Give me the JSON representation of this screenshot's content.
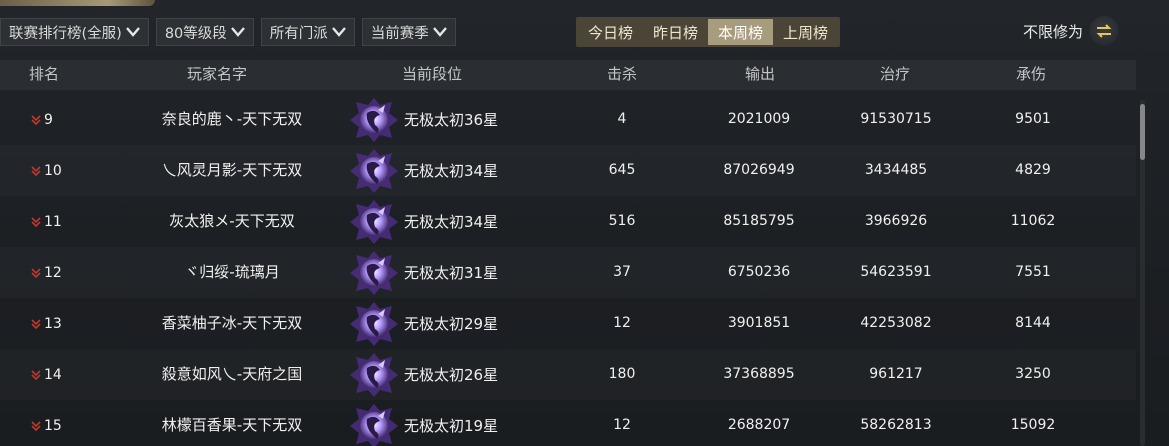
{
  "filters": [
    {
      "label": "联赛排行榜(全服)"
    },
    {
      "label": "80等级段"
    },
    {
      "label": "所有门派"
    },
    {
      "label": "当前赛季"
    }
  ],
  "tabs": [
    {
      "label": "今日榜",
      "active": false
    },
    {
      "label": "昨日榜",
      "active": false
    },
    {
      "label": "本周榜",
      "active": true
    },
    {
      "label": "上周榜",
      "active": false
    }
  ],
  "cultivation": {
    "label": "不限修为",
    "icon": "swap-arrows-icon"
  },
  "table": {
    "headers": {
      "rank": "排名",
      "name": "玩家名字",
      "tier": "当前段位",
      "kills": "击杀",
      "damage": "输出",
      "healing": "治疗",
      "taken": "承伤"
    },
    "rows": [
      {
        "rank": "9",
        "name": "奈良的鹿丶-天下无双",
        "tier": "无极太初36星",
        "kills": "4",
        "damage": "2021009",
        "healing": "91530715",
        "taken": "9501"
      },
      {
        "rank": "10",
        "name": "乀风灵月影-天下无双",
        "tier": "无极太初34星",
        "kills": "645",
        "damage": "87026949",
        "healing": "3434485",
        "taken": "4829"
      },
      {
        "rank": "11",
        "name": "灰太狼メ-天下无双",
        "tier": "无极太初34星",
        "kills": "516",
        "damage": "85185795",
        "healing": "3966926",
        "taken": "11062"
      },
      {
        "rank": "12",
        "name": "ヾ归绥-琉璃月",
        "tier": "无极太初31星",
        "kills": "37",
        "damage": "6750236",
        "healing": "54623591",
        "taken": "7551"
      },
      {
        "rank": "13",
        "name": "香菜柚子冰-天下无双",
        "tier": "无极太初29星",
        "kills": "12",
        "damage": "3901851",
        "healing": "42253082",
        "taken": "8144"
      },
      {
        "rank": "14",
        "name": "殺意如风乀-天府之国",
        "tier": "无极太初26星",
        "kills": "180",
        "damage": "37368895",
        "healing": "961217",
        "taken": "3250"
      },
      {
        "rank": "15",
        "name": "林檬百香果-天下无双",
        "tier": "无极太初19星",
        "kills": "12",
        "damage": "2688207",
        "healing": "58262813",
        "taken": "15092"
      }
    ]
  },
  "colors": {
    "tab_active": "#a89c7e",
    "tab_bg": "#4a4537",
    "rank_down": "#c0392b"
  }
}
